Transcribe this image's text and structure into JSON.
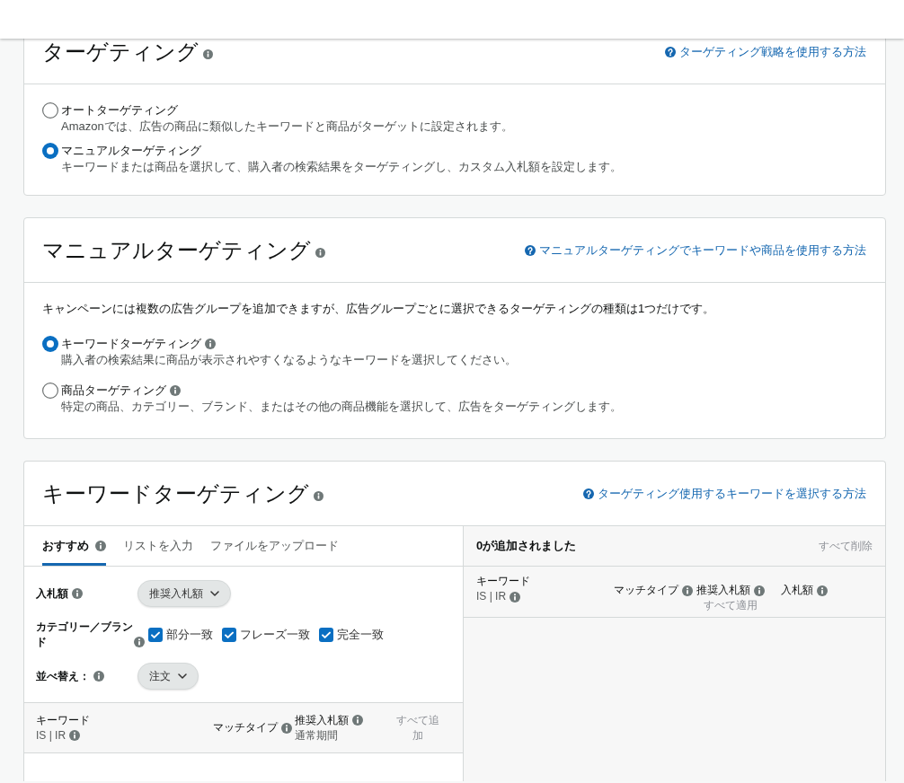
{
  "targeting": {
    "title": "ターゲティング",
    "help_link": "ターゲティング戦略を使用する方法",
    "options": [
      {
        "label": "オートターゲティング",
        "info": false,
        "description": "Amazonでは、広告の商品に類似したキーワードと商品がターゲットに設定されます。",
        "selected": false
      },
      {
        "label": "マニュアルターゲティング",
        "info": false,
        "description": "キーワードまたは商品を選択して、購入者の検索結果をターゲティングし、カスタム入札額を設定します。",
        "selected": true
      }
    ]
  },
  "manual_targeting": {
    "title": "マニュアルターゲティング",
    "help_link": "マニュアルターゲティングでキーワードや商品を使用する方法",
    "intro": "キャンペーンには複数の広告グループを追加できますが、広告グループごとに選択できるターゲティングの種類は1つだけです。",
    "options": [
      {
        "label": "キーワードターゲティング",
        "info": true,
        "description": "購入者の検索結果に商品が表示されやすくなるようなキーワードを選択してください。",
        "selected": true
      },
      {
        "label": "商品ターゲティング",
        "info": true,
        "description": "特定の商品、カテゴリー、ブランド、またはその他の商品機能を選択して、広告をターゲティングします。",
        "selected": false
      }
    ]
  },
  "keyword_targeting": {
    "title": "キーワードターゲティング",
    "help_link": "ターゲティング使用するキーワードを選択する方法",
    "tabs": [
      {
        "label": "おすすめ",
        "info": true,
        "selected": true
      },
      {
        "label": "リストを入力",
        "info": false,
        "selected": false
      },
      {
        "label": "ファイルをアップロード",
        "info": false,
        "selected": false
      }
    ],
    "filters": [
      {
        "kind": "dropdown",
        "label": "入札額",
        "value": "推奨入札額"
      },
      {
        "kind": "checkboxes",
        "label": "カテゴリー／ブランド",
        "options": [
          {
            "label": "部分一致",
            "checked": true
          },
          {
            "label": "フレーズ一致",
            "checked": true
          },
          {
            "label": "完全一致",
            "checked": true
          }
        ]
      },
      {
        "kind": "dropdown",
        "label": "並べ替え：",
        "value": "注文"
      }
    ],
    "results_table": {
      "columns": [
        {
          "kind": "text",
          "label": "キーワード",
          "info": false,
          "sublabel": {
            "kind": "note",
            "text": "IS | IR",
            "info": true
          }
        },
        {
          "kind": "text",
          "label": "マッチタイプ",
          "info": true
        },
        {
          "kind": "text",
          "label": "推奨入札額",
          "info": true,
          "sublabel": {
            "kind": "note",
            "text": "通常期間",
            "info": false
          }
        },
        {
          "kind": "action",
          "label": "すべて追加",
          "disabled": true
        }
      ]
    },
    "added_panel": {
      "title": "0が追加されました",
      "clear_all": {
        "label": "すべて削除",
        "disabled": true
      },
      "columns": [
        {
          "kind": "text",
          "label": "キーワード",
          "info": false,
          "sublabel": {
            "kind": "note",
            "text": "IS | IR",
            "info": true
          }
        },
        {
          "kind": "text",
          "label": "マッチタイプ",
          "info": true
        },
        {
          "kind": "text",
          "label": "推奨入札額",
          "info": true,
          "sublabel": {
            "kind": "action",
            "text": "すべて適用",
            "disabled": true
          }
        },
        {
          "kind": "text",
          "label": "入札額",
          "info": true
        }
      ]
    }
  }
}
